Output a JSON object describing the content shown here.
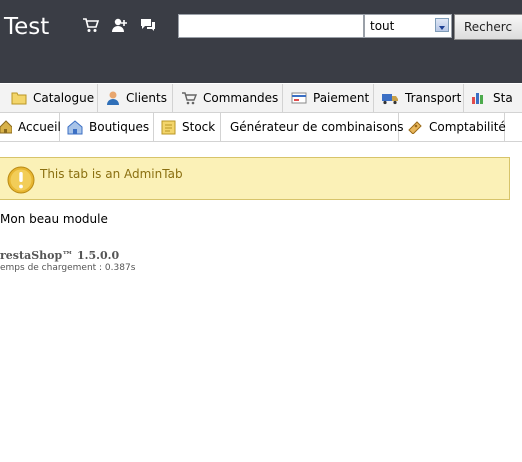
{
  "header": {
    "shop_title": "Test",
    "icons": [
      "cart-icon",
      "customer-icon",
      "messages-icon"
    ],
    "search": {
      "value": "",
      "placeholder": "",
      "select_value": "tout",
      "button_label": "Recherc"
    }
  },
  "tabs_row1": [
    {
      "label": "Catalogue",
      "icon": "folder-icon"
    },
    {
      "label": "Clients",
      "icon": "customers-icon"
    },
    {
      "label": "Commandes",
      "icon": "cart-icon"
    },
    {
      "label": "Paiement",
      "icon": "payment-icon"
    },
    {
      "label": "Transport",
      "icon": "truck-icon"
    },
    {
      "label": "Sta",
      "icon": "stats-icon"
    }
  ],
  "tabs_row2": [
    {
      "label": "Accueil",
      "icon": "home-icon"
    },
    {
      "label": "Boutiques",
      "icon": "shop-icon"
    },
    {
      "label": "Stock",
      "icon": "stock-icon"
    },
    {
      "label": "Générateur de combinaisons",
      "icon": ""
    },
    {
      "label": "Comptabilité",
      "icon": "accounting-icon"
    }
  ],
  "alert": {
    "text": "This tab is an AdminTab",
    "icon": "warning-icon",
    "colors": {
      "background": "#fbf1b7",
      "text": "#8a6f10"
    }
  },
  "content": {
    "module_title": "Mon beau module"
  },
  "footer": {
    "brand": "restaShop™ 1.5.0.0",
    "load_time": "emps de chargement : 0.387s"
  },
  "colors": {
    "header_bg": "#3a3d45"
  }
}
